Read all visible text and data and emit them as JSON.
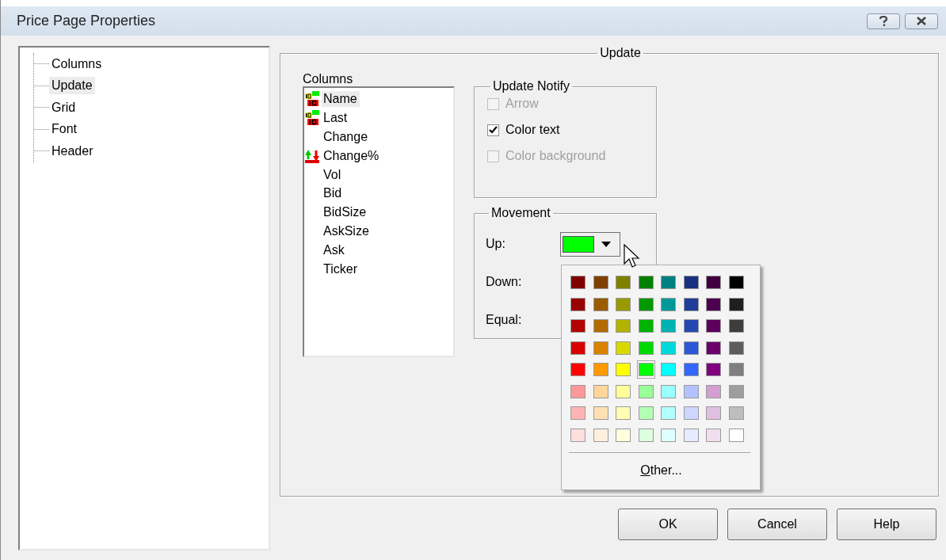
{
  "window": {
    "title": "Price Page Properties"
  },
  "tree": {
    "items": [
      {
        "label": "Columns",
        "selected": false
      },
      {
        "label": "Update",
        "selected": true
      },
      {
        "label": "Grid",
        "selected": false
      },
      {
        "label": "Font",
        "selected": false
      },
      {
        "label": "Header",
        "selected": false
      }
    ]
  },
  "update_group": {
    "title": "Update",
    "columns": {
      "label": "Columns",
      "items": [
        {
          "label": "Name",
          "kind": "digits",
          "selected": true
        },
        {
          "label": "Last",
          "kind": "digits",
          "selected": false
        },
        {
          "label": "Change",
          "kind": "plain",
          "selected": false
        },
        {
          "label": "Change%",
          "kind": "arrows",
          "selected": false
        },
        {
          "label": "Vol",
          "kind": "plain",
          "selected": false
        },
        {
          "label": "Bid",
          "kind": "plain",
          "selected": false
        },
        {
          "label": "BidSize",
          "kind": "plain",
          "selected": false
        },
        {
          "label": "AskSize",
          "kind": "plain",
          "selected": false
        },
        {
          "label": "Ask",
          "kind": "plain",
          "selected": false
        },
        {
          "label": "Ticker",
          "kind": "plain",
          "selected": false
        }
      ]
    },
    "update_notify": {
      "title": "Update Notify",
      "options": [
        {
          "label": "Arrow",
          "checked": false,
          "disabled": true
        },
        {
          "label": "Color text",
          "checked": true,
          "disabled": false
        },
        {
          "label": "Color background",
          "checked": false,
          "disabled": true
        }
      ]
    },
    "movement": {
      "title": "Movement",
      "rows": [
        {
          "label": "Up:",
          "color": "#00ff00"
        },
        {
          "label": "Down:"
        },
        {
          "label": "Equal:"
        }
      ]
    }
  },
  "color_popup": {
    "swatches": [
      [
        {
          "color": "#800000",
          "selected": false
        },
        {
          "color": "#804000",
          "selected": false
        },
        {
          "color": "#808000",
          "selected": false
        },
        {
          "color": "#008000",
          "selected": false
        },
        {
          "color": "#008080",
          "selected": false
        },
        {
          "color": "#1a3080",
          "selected": false
        },
        {
          "color": "#400040",
          "selected": false
        },
        {
          "color": "#000000",
          "selected": false
        }
      ],
      [
        {
          "color": "#990000",
          "selected": false
        },
        {
          "color": "#995c00",
          "selected": false
        },
        {
          "color": "#999900",
          "selected": false
        },
        {
          "color": "#009900",
          "selected": false
        },
        {
          "color": "#009999",
          "selected": false
        },
        {
          "color": "#1f3d99",
          "selected": false
        },
        {
          "color": "#4d004d",
          "selected": false
        },
        {
          "color": "#1f1f1f",
          "selected": false
        }
      ],
      [
        {
          "color": "#b30000",
          "selected": false
        },
        {
          "color": "#b36b00",
          "selected": false
        },
        {
          "color": "#b3b300",
          "selected": false
        },
        {
          "color": "#00b300",
          "selected": false
        },
        {
          "color": "#00b3b3",
          "selected": false
        },
        {
          "color": "#2448b3",
          "selected": false
        },
        {
          "color": "#5c005c",
          "selected": false
        },
        {
          "color": "#3d3d3d",
          "selected": false
        }
      ],
      [
        {
          "color": "#d90000",
          "selected": false
        },
        {
          "color": "#d98200",
          "selected": false
        },
        {
          "color": "#d9d900",
          "selected": false
        },
        {
          "color": "#00d900",
          "selected": false
        },
        {
          "color": "#00d9d9",
          "selected": false
        },
        {
          "color": "#2b57d9",
          "selected": false
        },
        {
          "color": "#6b006b",
          "selected": false
        },
        {
          "color": "#5c5c5c",
          "selected": false
        }
      ],
      [
        {
          "color": "#ff0000",
          "selected": false
        },
        {
          "color": "#ff9900",
          "selected": false
        },
        {
          "color": "#ffff00",
          "selected": false
        },
        {
          "color": "#00ff00",
          "selected": true
        },
        {
          "color": "#00ffff",
          "selected": false
        },
        {
          "color": "#3366ff",
          "selected": false
        },
        {
          "color": "#800080",
          "selected": false
        },
        {
          "color": "#7f7f7f",
          "selected": false
        }
      ],
      [
        {
          "color": "#ff9999",
          "selected": false
        },
        {
          "color": "#ffd699",
          "selected": false
        },
        {
          "color": "#ffff99",
          "selected": false
        },
        {
          "color": "#99ff99",
          "selected": false
        },
        {
          "color": "#99ffff",
          "selected": false
        },
        {
          "color": "#b3c2ff",
          "selected": false
        },
        {
          "color": "#d19fd1",
          "selected": false
        },
        {
          "color": "#9e9e9e",
          "selected": false
        }
      ],
      [
        {
          "color": "#ffb3b3",
          "selected": false
        },
        {
          "color": "#ffe0b3",
          "selected": false
        },
        {
          "color": "#ffffb3",
          "selected": false
        },
        {
          "color": "#b3ffb3",
          "selected": false
        },
        {
          "color": "#b3ffff",
          "selected": false
        },
        {
          "color": "#ccd6ff",
          "selected": false
        },
        {
          "color": "#e0bfe0",
          "selected": false
        },
        {
          "color": "#bdbdbd",
          "selected": false
        }
      ],
      [
        {
          "color": "#ffdede",
          "selected": false
        },
        {
          "color": "#fff0de",
          "selected": false
        },
        {
          "color": "#ffffde",
          "selected": false
        },
        {
          "color": "#deffde",
          "selected": false
        },
        {
          "color": "#deffff",
          "selected": false
        },
        {
          "color": "#e6ebff",
          "selected": false
        },
        {
          "color": "#f0deef",
          "selected": false
        },
        {
          "color": "#ffffff",
          "selected": false
        }
      ]
    ],
    "other_button": {
      "label": "Other..."
    }
  },
  "buttons": [
    "OK",
    "Cancel",
    "Help"
  ]
}
